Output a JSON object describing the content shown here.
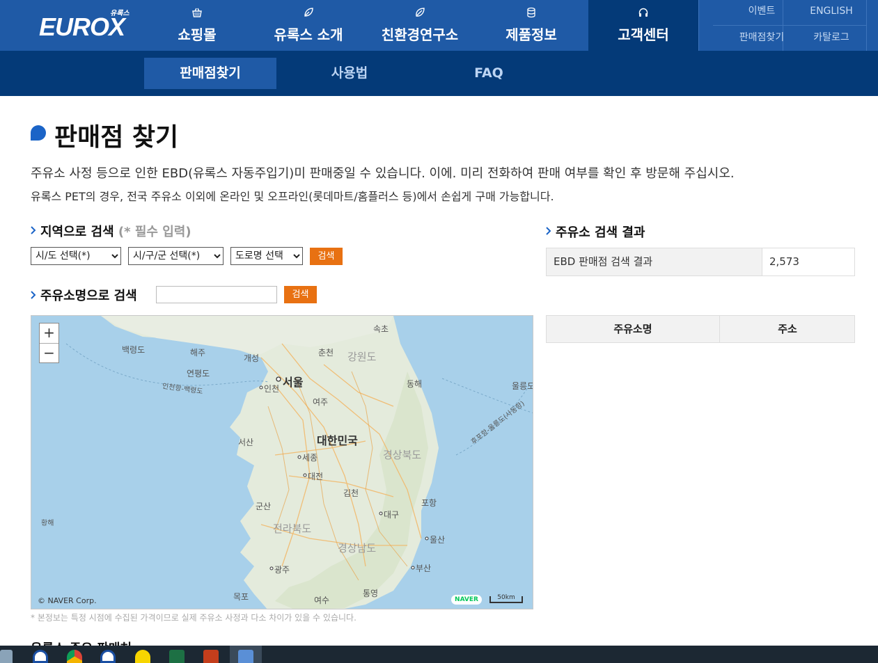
{
  "brand": {
    "logo_text": "EUROX",
    "logo_sub": "유록스"
  },
  "nav": {
    "items": [
      {
        "label": "쇼핑몰",
        "icon": "basket-icon"
      },
      {
        "label": "유록스 소개",
        "icon": "leaf-pen-icon"
      },
      {
        "label": "친환경연구소",
        "icon": "leaf-icon"
      },
      {
        "label": "제품정보",
        "icon": "database-icon"
      },
      {
        "label": "고객센터",
        "icon": "headset-icon"
      }
    ],
    "util": [
      "이벤트",
      "ENGLISH",
      "판매점찾기",
      "카탈로그"
    ]
  },
  "subnav": {
    "items": [
      "판매점찾기",
      "사용법",
      "FAQ"
    ]
  },
  "page": {
    "title": "판매점 찾기",
    "desc1": "주유소 사정 등으로 인한 EBD(유록스 자동주입기)미 판매중일 수 있습니다. 이에. 미리 전화하여 판매 여부를 확인 후 방문해 주십시오.",
    "desc2": "유록스 PET의 경우, 전국 주유소 이외에 온라인 및 오프라인(롯데마트/홈플러스 등)에서 손쉽게 구매 가능합니다."
  },
  "region_search": {
    "label": "지역으로 검색",
    "required": "(* 필수 입력)",
    "sido": "시/도 선택(*)",
    "sigungu": "시/구/군 선택(*)",
    "road": "도로명 선택",
    "button": "검색"
  },
  "name_search": {
    "label": "주유소명으로 검색",
    "value": "",
    "button": "검색"
  },
  "map": {
    "copyright": "© NAVER Corp.",
    "naver": "NAVER",
    "scale": "50km",
    "labels": {
      "seoul": "서울",
      "incheon": "인천",
      "country": "대한민국",
      "sokcho": "속초",
      "chuncheon": "춘천",
      "gangwon": "강원도",
      "gaeseong": "개성",
      "haeju": "해주",
      "baengnyeong": "백령도",
      "yeonpyeong": "연평도",
      "donghae": "동해",
      "ulleung": "울릉도",
      "yeoju": "여주",
      "seosan": "서산",
      "sejong": "세종",
      "daejeon": "대전",
      "gyeongbuk": "경상북도",
      "gimcheon": "김천",
      "pohang": "포항",
      "gunsan": "군산",
      "daegu": "대구",
      "hwanghae": "황해",
      "jeonbuk": "전라북도",
      "gyeongnam": "경상남도",
      "ulsan": "울산",
      "gwangju": "광주",
      "busan": "부산",
      "tongyeong": "통영",
      "mokpo": "목포",
      "yeosu": "여수",
      "route1": "인천항-백령도",
      "route2": "후포항-울릉도(사동항)"
    }
  },
  "note": "* 본정보는 특정 시점에 수집된 가격이므로 실제 주유소 사정과 다소 차이가 있을 수 있습니다.",
  "results": {
    "label": "주유소 검색 결과",
    "row_label": "EBD 판매점 검색 결과",
    "count": "2,573",
    "col_name": "주유소명",
    "col_addr": "주소"
  },
  "cut_heading": "유록스 주요 판매처",
  "colors": {
    "header": "#1f5aa6",
    "subheader": "#043a78",
    "accent": "#e87112"
  }
}
